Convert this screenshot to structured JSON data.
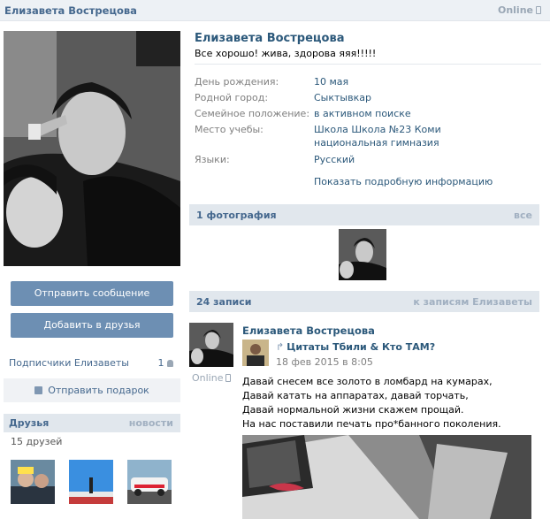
{
  "header": {
    "name": "Елизавета Вострецова",
    "online": "Online"
  },
  "profile": {
    "name": "Елизавета Вострецова",
    "status": "Все хорошо! жива, здорова яяя!!!!!",
    "info": [
      {
        "label": "День рождения:",
        "value": "10 мая"
      },
      {
        "label": "Родной город:",
        "value": "Сыктывкар"
      },
      {
        "label": "Семейное положение:",
        "value": "в активном поиске"
      },
      {
        "label": "Место учебы:",
        "value": "Школа Школа №23 Коми национальная гимназия"
      },
      {
        "label": "Языки:",
        "value": "Русский"
      }
    ],
    "more_info": "Показать подробную информацию"
  },
  "sidebar": {
    "send_message": "Отправить сообщение",
    "add_friend": "Добавить в друзья",
    "followers_label": "Подписчики Елизаветы",
    "followers_count": "1",
    "send_gift": "Отправить подарок",
    "friends_title": "Друзья",
    "friends_news": "новости",
    "friends_count": "15 друзей"
  },
  "photos": {
    "title": "1 фотография",
    "all": "все"
  },
  "wall": {
    "title": "24 записи",
    "link": "к записям Елизаветы",
    "post": {
      "author": "Елизавета Вострецова",
      "online": "Online",
      "repost_name": "Цитаты Тбили & Кто ТАМ?",
      "repost_date": "18 фев 2015 в 8:05",
      "lines": [
        "Давай снесем все золото в ломбард на кумарах,",
        "Давай катать на аппаратах, давай торчать,",
        "Давай нормальной жизни скажем прощай.",
        "На нас поставили печать про*банного поколения."
      ]
    }
  },
  "colors": {
    "link": "#2b587a",
    "button": "#6d8fb3",
    "header_bg": "#e1e7ed"
  }
}
